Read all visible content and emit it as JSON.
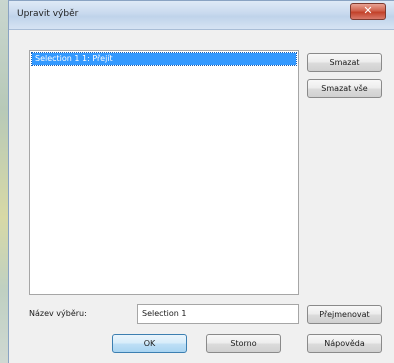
{
  "window": {
    "title": "Upravit výběr",
    "close_symbol": "✕"
  },
  "selection_list": {
    "items": [
      {
        "label": "Selection 1 1: Přejít",
        "selected": true
      }
    ]
  },
  "buttons": {
    "delete": "Smazat",
    "delete_all": "Smazat vše",
    "rename": "Přejmenovat",
    "ok": "OK",
    "cancel": "Storno",
    "help": "Nápověda"
  },
  "name_field": {
    "label": "Název výběru:",
    "value": "Selection 1"
  }
}
